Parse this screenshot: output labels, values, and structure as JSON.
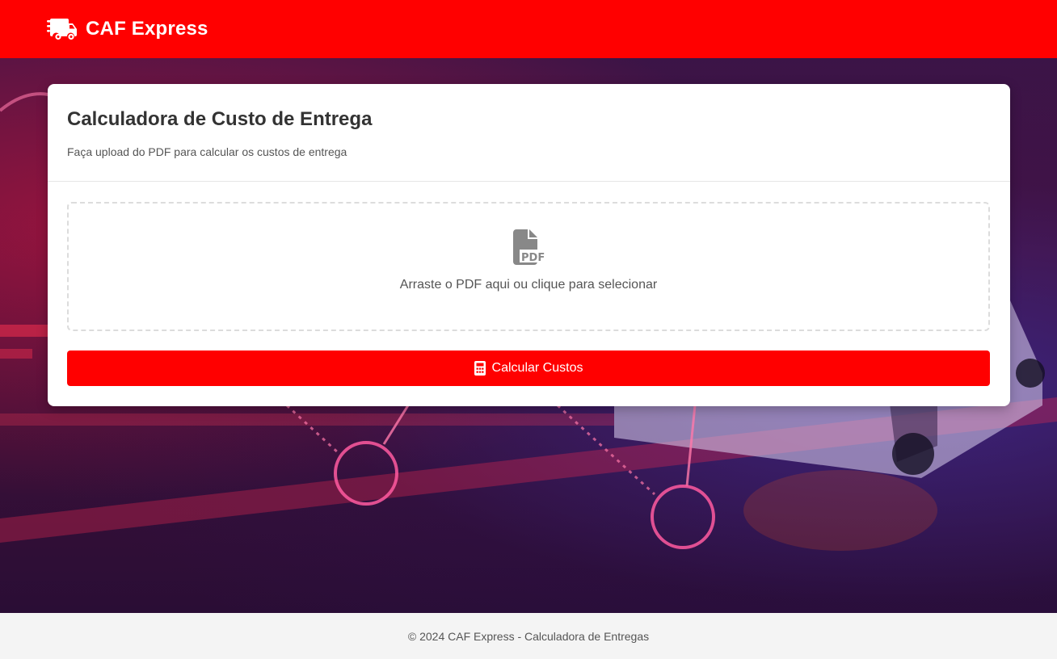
{
  "header": {
    "brand": "CAF Express",
    "logo_icon": "truck-fast-icon"
  },
  "card": {
    "title": "Calculadora de Custo de Entrega",
    "subtitle": "Faça upload do PDF para calcular os custos de entrega",
    "dropzone": {
      "icon": "file-pdf-icon",
      "text": "Arraste o PDF aqui ou clique para selecionar"
    },
    "calculate_button": {
      "icon": "calculator-icon",
      "label": "Calcular Custos"
    }
  },
  "footer": {
    "text": "© 2024 CAF Express - Calculadora de Entregas"
  },
  "colors": {
    "brand_red": "#ff0000",
    "background_purple": "#3b1447"
  }
}
